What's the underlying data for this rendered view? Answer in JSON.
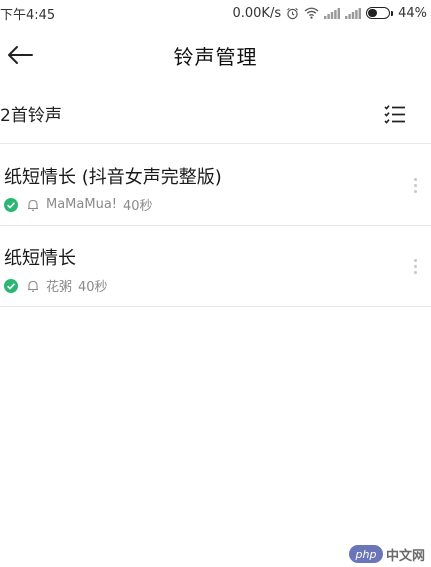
{
  "status_bar": {
    "time": "下午4:45",
    "network_speed": "0.00K/s",
    "battery_percent": "44%",
    "battery_level": 0.44,
    "icons": [
      "alarm-icon",
      "wifi-icon",
      "signal-icon",
      "signal-icon",
      "battery-icon"
    ]
  },
  "header": {
    "title": "铃声管理",
    "back_icon": "arrow-left-icon"
  },
  "count_bar": {
    "label": "2首铃声",
    "list_icon": "checklist-icon"
  },
  "ringtones": [
    {
      "title": "纸短情长 (抖音女声完整版)",
      "artist": "MaMaMua!",
      "duration": "40秒"
    },
    {
      "title": "纸短情长",
      "artist": "花粥",
      "duration": "40秒"
    }
  ],
  "watermark": {
    "logo": "php",
    "text": "中文网"
  },
  "colors": {
    "accent_green": "#2bb673",
    "divider": "#e8e8e8",
    "meta_text": "#8a8a8a"
  }
}
